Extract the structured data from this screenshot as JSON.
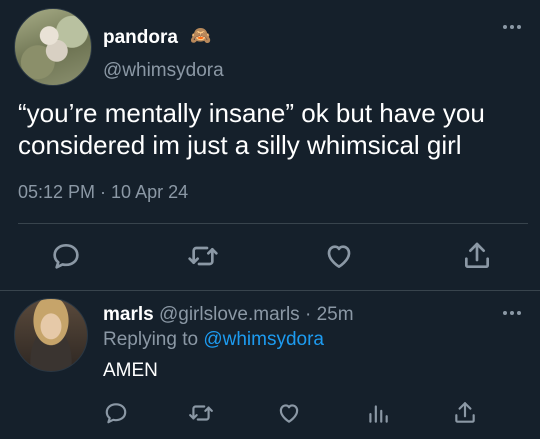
{
  "tweet": {
    "display_name": "pandora",
    "emoji": "🙈",
    "handle": "@whimsydora",
    "text": "“you’re mentally insane” ok but have you considered im just a silly whimsical girl",
    "time": "05:12 PM · 10 Apr 24",
    "actions": [
      "reply-icon",
      "retweet-icon",
      "like-icon",
      "share-icon"
    ]
  },
  "reply": {
    "display_name": "marls",
    "handle_time": "@girlslove.marls · 25m",
    "replying_prefix": "Replying to",
    "replying_to": "@whimsydora",
    "text": "AMEN",
    "actions": [
      "reply-icon",
      "retweet-icon",
      "like-icon",
      "analytics-icon",
      "share-icon"
    ]
  },
  "colors": {
    "background": "#15202b",
    "secondary_text": "#8b98a5",
    "link": "#1d9bf0",
    "divider": "#38444d"
  }
}
